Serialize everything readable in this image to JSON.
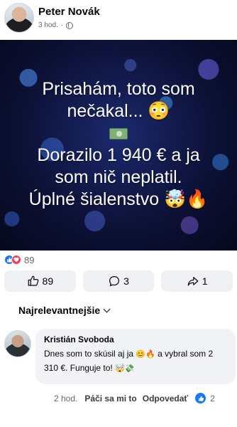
{
  "post": {
    "author": "Peter Novák",
    "time": "3 hod.",
    "audience_icon": "globe-icon",
    "image_lines": [
      "Prisahám, toto som",
      "nečakal... 😳",
      "Dorazilo 1 940 € a ja",
      "som nič neplatil.",
      "Úplné šialenstvo 🤯🔥"
    ],
    "money_icon": "money-bill-icon"
  },
  "reactions": {
    "count": "89",
    "types": [
      "like",
      "love"
    ]
  },
  "actions": {
    "like_count": "89",
    "comment_count": "3",
    "share_count": "1"
  },
  "comments": {
    "sort_label": "Najrelevantnejšie",
    "items": [
      {
        "author": "Kristián Svoboda",
        "text_part1": "Dnes som to skúsil aj ja ",
        "emoji1": "😊🔥",
        "text_part2": " a vybral som 2 310 €. Funguje to! ",
        "emoji2": "🤯💸",
        "time": "2 hod.",
        "like_label": "Páči sa mi to",
        "reply_label": "Odpovedať",
        "reaction_count": "2"
      }
    ]
  },
  "colors": {
    "accent": "#1877f2",
    "love": "#f33e58",
    "bubble": "#f0f2f5",
    "secondary_text": "#65676b"
  }
}
